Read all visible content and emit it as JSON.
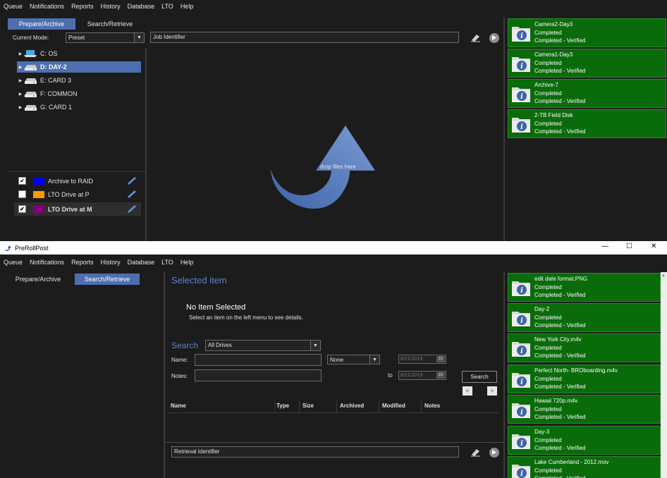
{
  "menu": [
    "Queue",
    "Notifications",
    "Reports",
    "History",
    "Database",
    "LTO",
    "Help"
  ],
  "win1": {
    "tabs": {
      "prepare": "Prepare/Archive",
      "search": "Search/Retrieve"
    },
    "current_mode_label": "Current Mode:",
    "mode_value": "Preset",
    "job_identifier_placeholder": "Job Identifier",
    "drives": [
      {
        "label": "C: OS",
        "icon": "os-drive-icon"
      },
      {
        "label": "D: DAY-2",
        "icon": "drive-icon"
      },
      {
        "label": "E: CARD 3",
        "icon": "drive-icon"
      },
      {
        "label": "F: COMMON",
        "icon": "drive-icon"
      },
      {
        "label": "G: CARD 1",
        "icon": "drive-icon"
      }
    ],
    "drop_text": "drop files here",
    "destinations": [
      {
        "label": "Archive to RAID",
        "color": "#0000ff",
        "checked": "✔"
      },
      {
        "label": "LTO Drive at P",
        "color": "#ff9900",
        "checked": ""
      },
      {
        "label": "LTO Drive at M",
        "color": "#800080",
        "checked": "✔"
      }
    ],
    "queue": [
      {
        "name": "Camera2-Day3",
        "status": "Completed",
        "detail": "Completed - Verified"
      },
      {
        "name": "Camera1-Day3",
        "status": "Completed",
        "detail": "Completed - Verified"
      },
      {
        "name": "Archive-7",
        "status": "Completed",
        "detail": "Completed - Verified"
      },
      {
        "name": "2-TB Field Disk",
        "status": "Completed",
        "detail": "Completed - Verified"
      }
    ]
  },
  "win2": {
    "app_title": "PreRollPost",
    "window_controls": {
      "minimize": "—",
      "maximize": "☐",
      "close": "✕"
    },
    "tabs": {
      "prepare": "Prepare/Archive",
      "search": "Search/Retrieve"
    },
    "selected_item_heading": "Selected item",
    "no_item_title": "No Item Selected",
    "no_item_hint": "Select an item on the left menu to see details.",
    "search_label": "Search",
    "drive_filter": "All Drives",
    "name_label": "Name:",
    "notes_label": "Notes:",
    "none_option": "None",
    "date_from": "8/21/2019",
    "date_to": "8/21/2019",
    "to_label": "to",
    "calendar_glyph": "15",
    "search_button": "Search",
    "prev_glyph": "<",
    "next_glyph": ">",
    "columns": [
      "Name",
      "Type",
      "Size",
      "Archived",
      "Modified",
      "Notes"
    ],
    "retrieval_placeholder": "Retrieval Identifier",
    "queue": [
      {
        "name": "edit date format.PNG",
        "status": "Completed",
        "detail": "Completed - Verified"
      },
      {
        "name": "Day-2",
        "status": "Completed",
        "detail": "Completed - Verified"
      },
      {
        "name": "New York City.m4v",
        "status": "Completed",
        "detail": "Completed - Verified"
      },
      {
        "name": "Perfect North- BROboarding.m4v",
        "status": "Completed",
        "detail": "Completed - Verified"
      },
      {
        "name": "Hawaii 720p.m4v",
        "status": "Completed",
        "detail": "Completed - Verified"
      },
      {
        "name": "Day-3",
        "status": "Completed",
        "detail": "Completed - Verified"
      },
      {
        "name": "Lake Cumberland - 2012.mov",
        "status": "Completed",
        "detail": "Completed - Verified"
      }
    ]
  }
}
